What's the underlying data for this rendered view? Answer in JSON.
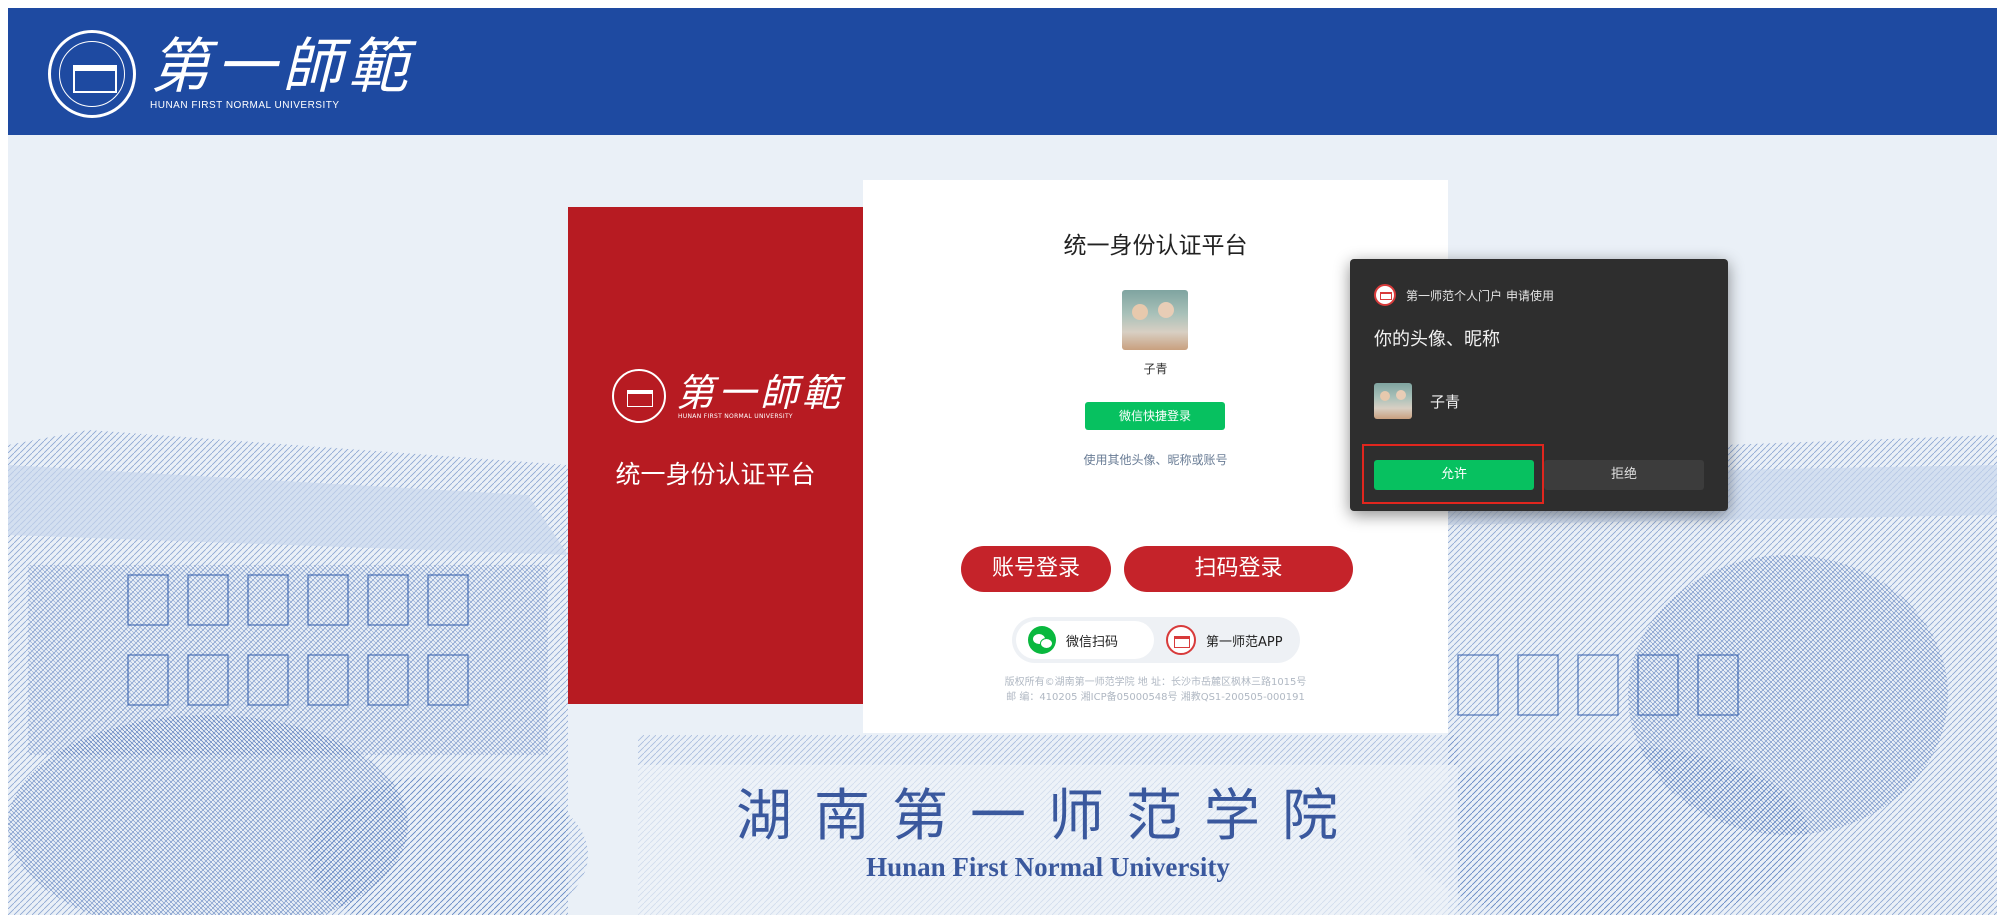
{
  "header": {
    "logo_cn": "第一師範",
    "logo_en": "HUNAN FIRST NORMAL UNIVERSITY"
  },
  "side_panel": {
    "logo_cn": "第一師範",
    "logo_en": "HUNAN FIRST NORMAL UNIVERSITY",
    "title": "统一身份认证平台"
  },
  "login": {
    "title": "统一身份认证平台",
    "nickname": "子青",
    "wechat_quick_login": "微信快捷登录",
    "other_account_link": "使用其他头像、昵称或账号",
    "account_login": "账号登录",
    "scan_login": "扫码登录",
    "switch_wechat": "微信扫码",
    "switch_app": "第一师范APP",
    "copyright_line1": "版权所有©湖南第一师范学院 地 址：长沙市岳麓区枫林三路1015号",
    "copyright_line2": "邮 编：410205 湘ICP备05000548号 湘教QS1-200505-000191"
  },
  "auth_popup": {
    "app_name": "第一师范个人门户",
    "request_text": "申请使用",
    "title": "你的头像、昵称",
    "nickname": "子青",
    "allow": "允许",
    "deny": "拒绝"
  },
  "background": {
    "sign_cn": "湖南第一师范学院",
    "sign_en": "Hunan First Normal University"
  },
  "colors": {
    "header_blue": "#1e4aa1",
    "brand_red": "#b71b22",
    "wechat_green": "#07c160",
    "popup_dark": "#2e2e2e",
    "highlight_red": "#e0261e"
  }
}
